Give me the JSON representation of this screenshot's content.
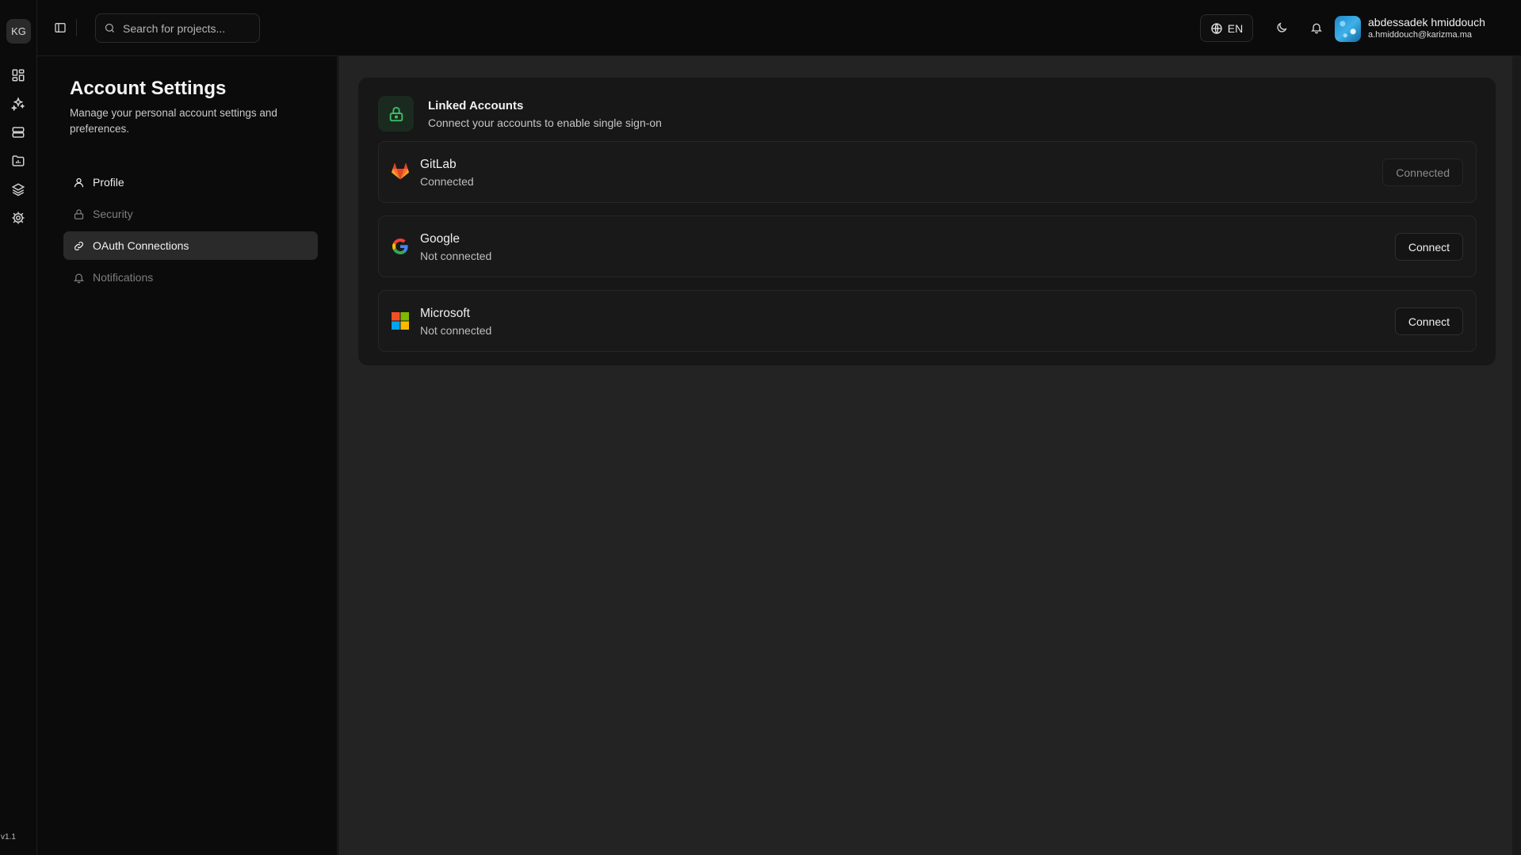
{
  "rail": {
    "logo_text": "KG",
    "icons": [
      "dashboard-icon",
      "sparkles-icon",
      "server-icon",
      "folder-chart-icon",
      "layers-icon",
      "settings-icon"
    ],
    "version": "v1.1"
  },
  "topbar": {
    "search_placeholder": "Search for projects...",
    "language": "EN",
    "user": {
      "name": "abdessadek hmiddouch",
      "email": "a.hmiddouch@karizma.ma"
    }
  },
  "settings": {
    "title": "Account Settings",
    "subtitle": "Manage your personal account settings and preferences.",
    "nav": [
      {
        "label": "Profile",
        "state": "normal"
      },
      {
        "label": "Security",
        "state": "muted"
      },
      {
        "label": "OAuth Connections",
        "state": "active"
      },
      {
        "label": "Notifications",
        "state": "muted"
      }
    ]
  },
  "linked_accounts": {
    "title": "Linked Accounts",
    "subtitle": "Connect your accounts to enable single sign-on",
    "providers": [
      {
        "name": "GitLab",
        "status": "Connected",
        "button": "Connected",
        "icon": "gitlab-icon"
      },
      {
        "name": "Google",
        "status": "Not connected",
        "button": "Connect",
        "icon": "google-icon"
      },
      {
        "name": "Microsoft",
        "status": "Not connected",
        "button": "Connect",
        "icon": "microsoft-icon"
      }
    ]
  },
  "colors": {
    "accent_green": "#3cc26a",
    "background": "#0b0b0b",
    "panel": "#232323"
  }
}
